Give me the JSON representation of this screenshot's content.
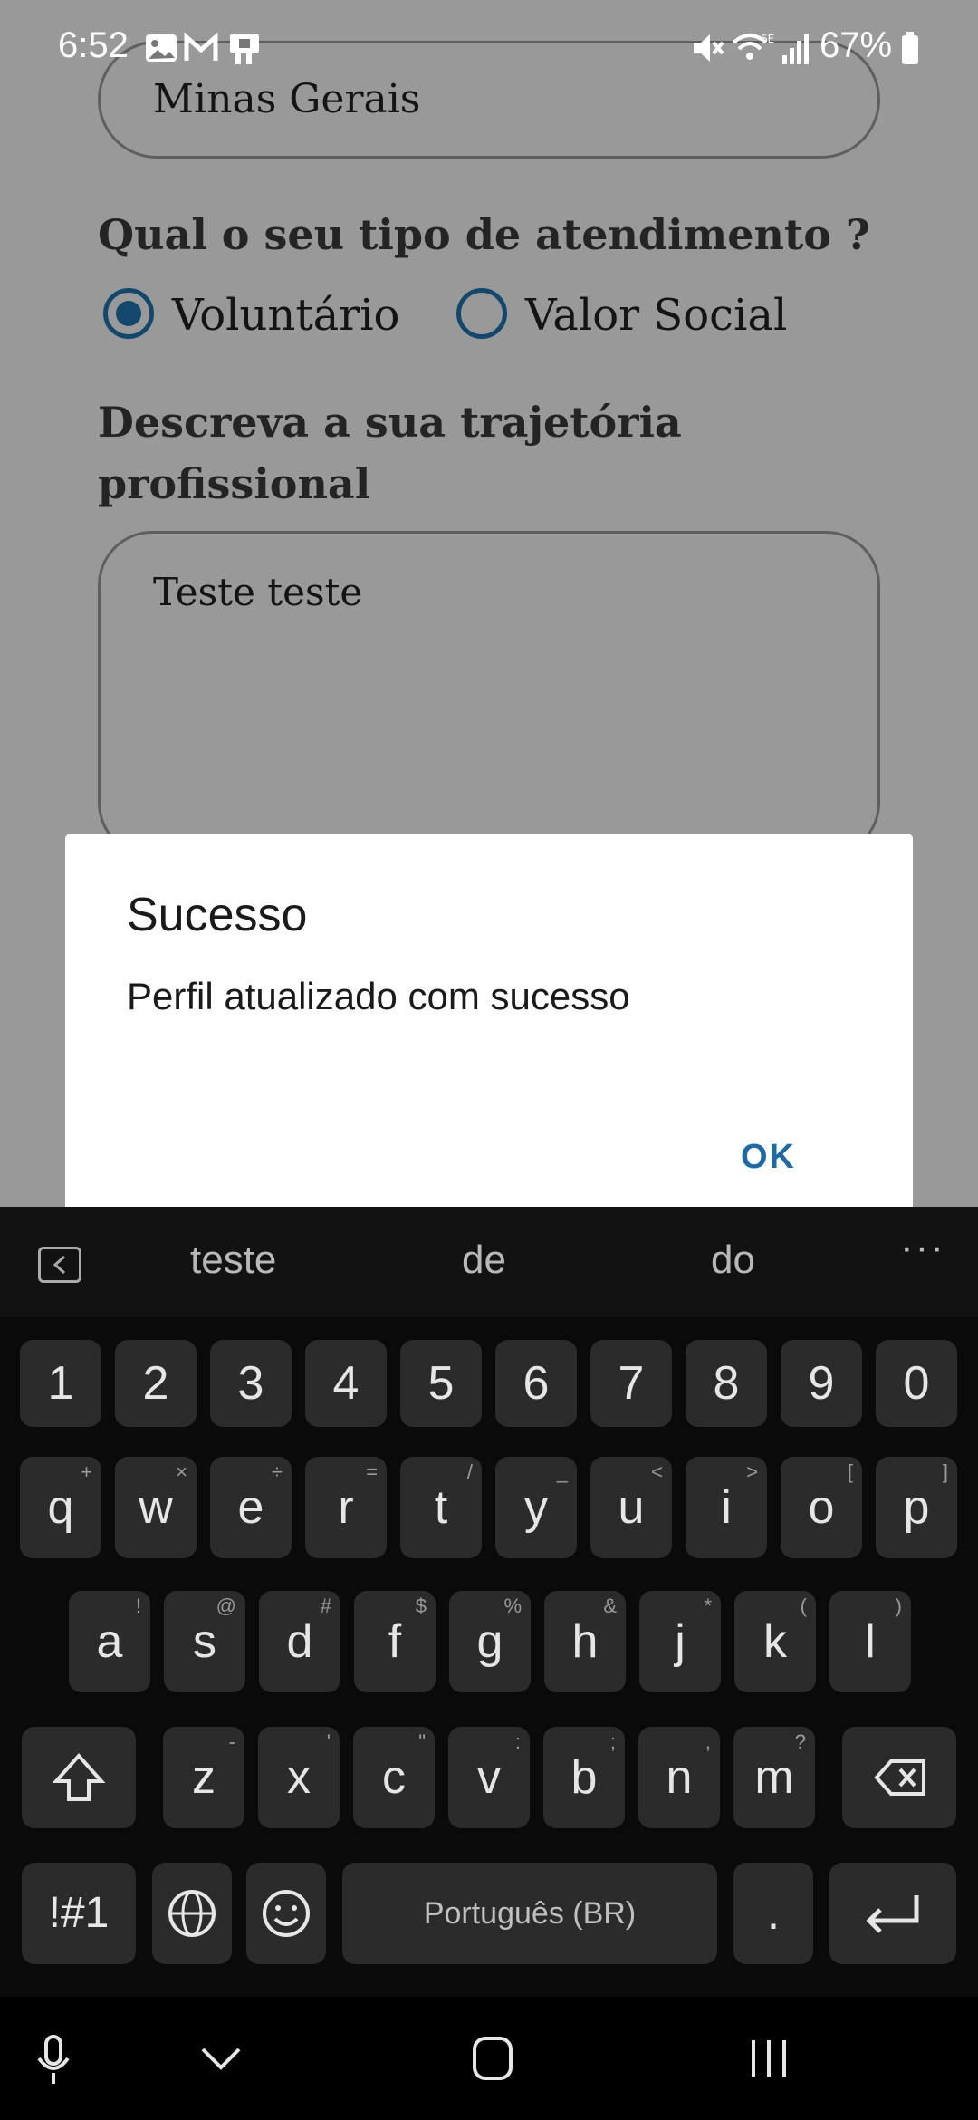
{
  "status_bar": {
    "time": "6:52",
    "battery": "67%"
  },
  "form": {
    "state_value": "Minas Gerais",
    "attendance_question": "Qual o seu tipo de atendimento ?",
    "attendance_options": [
      {
        "label": "Voluntário",
        "selected": true
      },
      {
        "label": "Valor Social",
        "selected": false
      }
    ],
    "career_question": "Descreva a sua trajetória profissional",
    "career_value": "Teste teste"
  },
  "dialog": {
    "title": "Sucesso",
    "message": "Perfil atualizado com sucesso",
    "ok_label": "OK"
  },
  "keyboard": {
    "suggestions": [
      "teste",
      "de",
      "do"
    ],
    "more": "···",
    "number_row": [
      "1",
      "2",
      "3",
      "4",
      "5",
      "6",
      "7",
      "8",
      "9",
      "0"
    ],
    "row1": [
      {
        "k": "q",
        "s": "+"
      },
      {
        "k": "w",
        "s": "×"
      },
      {
        "k": "e",
        "s": "÷"
      },
      {
        "k": "r",
        "s": "="
      },
      {
        "k": "t",
        "s": "/"
      },
      {
        "k": "y",
        "s": "_"
      },
      {
        "k": "u",
        "s": "<"
      },
      {
        "k": "i",
        "s": ">"
      },
      {
        "k": "o",
        "s": "["
      },
      {
        "k": "p",
        "s": "]"
      }
    ],
    "row2": [
      {
        "k": "a",
        "s": "!"
      },
      {
        "k": "s",
        "s": "@"
      },
      {
        "k": "d",
        "s": "#"
      },
      {
        "k": "f",
        "s": "$"
      },
      {
        "k": "g",
        "s": "%"
      },
      {
        "k": "h",
        "s": "&"
      },
      {
        "k": "j",
        "s": "*"
      },
      {
        "k": "k",
        "s": "("
      },
      {
        "k": "l",
        "s": ")"
      }
    ],
    "row3": [
      {
        "k": "z",
        "s": "-"
      },
      {
        "k": "x",
        "s": "'"
      },
      {
        "k": "c",
        "s": "\""
      },
      {
        "k": "v",
        "s": ":"
      },
      {
        "k": "b",
        "s": ";"
      },
      {
        "k": "n",
        "s": ","
      },
      {
        "k": "m",
        "s": "?"
      }
    ],
    "symbols_label": "!#1",
    "space_label": "Português (BR)",
    "period_label": "."
  },
  "colors": {
    "accent": "#1f78b4",
    "ok_text": "#1f6aa5",
    "key_bg": "#2b2b2b",
    "keyboard_bg": "#0a0a0a"
  }
}
